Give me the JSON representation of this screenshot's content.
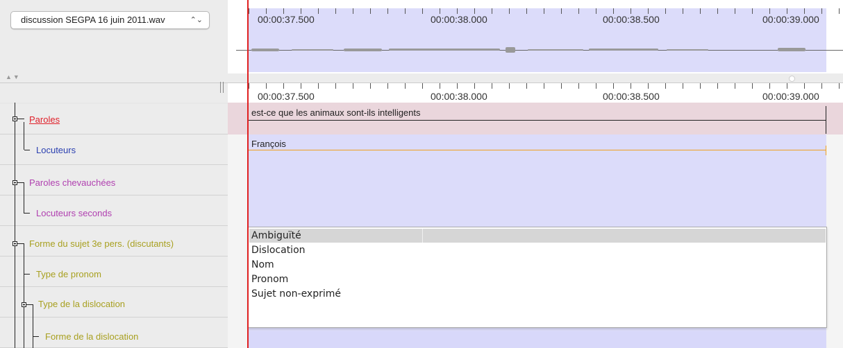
{
  "file": {
    "name": "discussion SEGPA 16 juin 2011.wav",
    "chevrons": "⌃⌄"
  },
  "ruler": {
    "times": [
      "00:00:37.500",
      "00:00:38.000",
      "00:00:38.500",
      "00:00:39.000"
    ]
  },
  "splitter": {
    "arrows": "▲▼"
  },
  "tiers": [
    {
      "label": "Paroles",
      "color": "#e0202a"
    },
    {
      "label": "Locuteurs",
      "color": "#2a3fb0"
    },
    {
      "label": "Paroles chevauchées",
      "color": "#b040b0"
    },
    {
      "label": "Locuteurs seconds",
      "color": "#b040b0"
    },
    {
      "label": "Forme du sujet 3e pers. (discutants)",
      "color": "#a8a020"
    },
    {
      "label": "Type de pronom",
      "color": "#a8a020"
    },
    {
      "label": "Type de la dislocation",
      "color": "#a8a020"
    },
    {
      "label": "Forme de la dislocation",
      "color": "#a8a020"
    }
  ],
  "segments": {
    "paroles_text": "est-ce que les animaux sont-ils intelligents",
    "locuteurs_text": "François"
  },
  "dropdown": {
    "options": [
      "Ambiguïté",
      "Dislocation",
      "Nom",
      "Pronom",
      "Sujet non-exprimé"
    ],
    "highlighted": "Ambiguïté"
  }
}
